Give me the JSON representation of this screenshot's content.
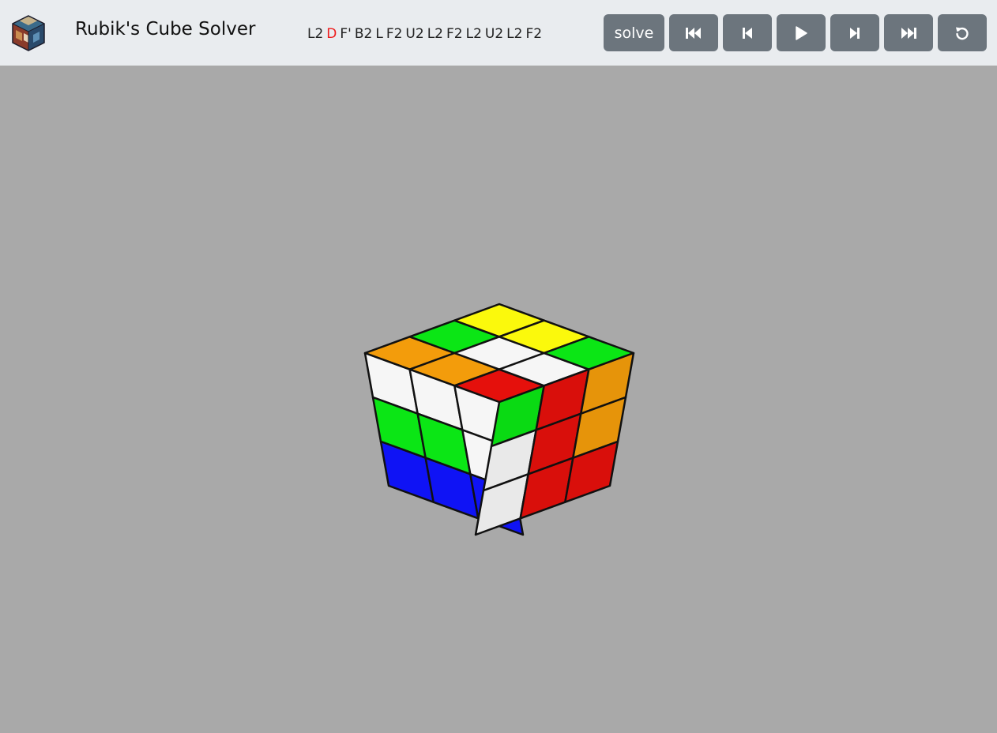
{
  "header": {
    "logo_icon": "rubiks-cube-logo-icon",
    "title": "Rubik's Cube Solver"
  },
  "solution": {
    "moves": [
      "L2",
      "D",
      "F'",
      "B2",
      "L",
      "F2",
      "U2",
      "L2",
      "F2",
      "L2",
      "U2",
      "L2",
      "F2"
    ],
    "current_index": 1,
    "highlight_color": "#ee1c1c"
  },
  "controls": {
    "solve_label": "solve",
    "first_icon": "skip-to-start-icon",
    "prev_icon": "step-back-icon",
    "play_icon": "play-icon",
    "next_icon": "step-forward-icon",
    "last_icon": "skip-to-end-icon",
    "reset_icon": "reset-icon"
  },
  "colors": {
    "header_bg": "#e9ecef",
    "button_bg": "#6c757d",
    "viewport_bg": "#a9a9a9"
  },
  "cube": {
    "top_face": [
      [
        "orange",
        "green",
        "yellow"
      ],
      [
        "orange",
        "white",
        "yellow"
      ],
      [
        "red",
        "white",
        "green"
      ]
    ],
    "left_face": [
      [
        "white",
        "white",
        "white"
      ],
      [
        "green",
        "green",
        "white"
      ],
      [
        "blue",
        "blue",
        "blue"
      ]
    ],
    "right_face": [
      [
        "green",
        "red",
        "orange"
      ],
      [
        "white",
        "red",
        "orange"
      ],
      [
        "white",
        "red",
        "red"
      ]
    ],
    "palette": {
      "white": "#f6f6f6",
      "yellow": "#fbf90c",
      "green": "#0be615",
      "orange": "#f39c0b",
      "red": "#e5100c",
      "blue": "#0f13f5"
    }
  }
}
